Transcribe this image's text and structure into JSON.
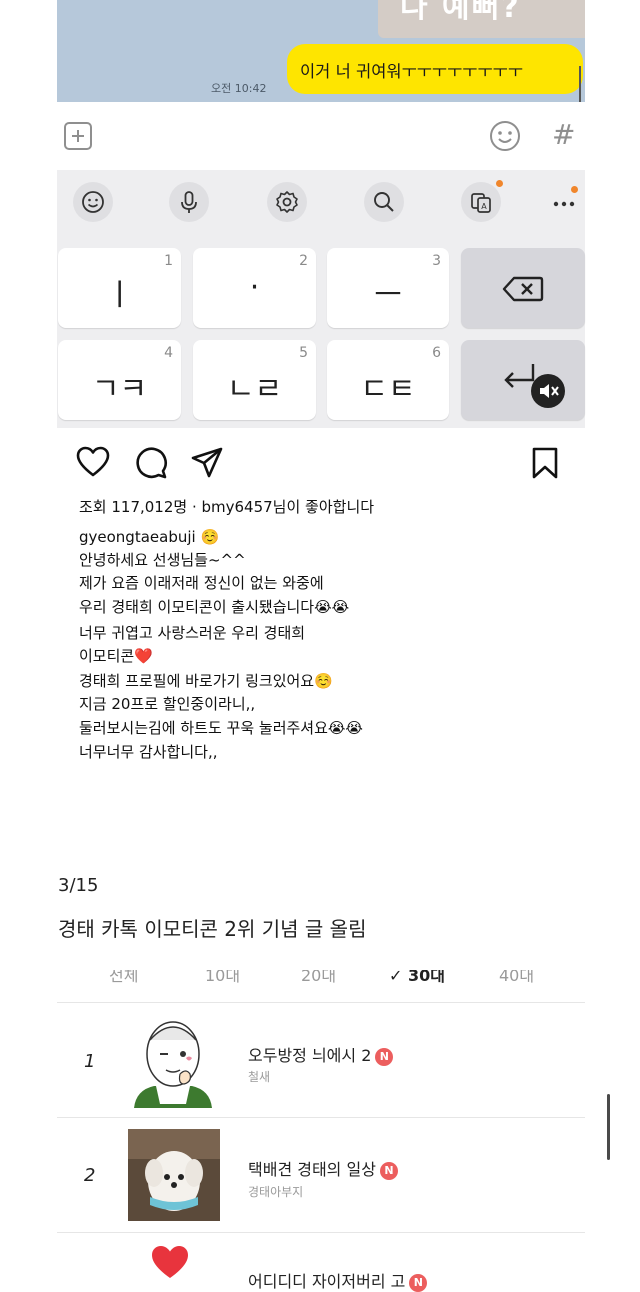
{
  "chat": {
    "photo_caption": "다 예뻐?",
    "my_message": "이거 너 귀여워ㅜㅜㅜㅜㅜㅜㅜㅜ",
    "time": "오전 10:42"
  },
  "input_bar": {
    "plus_icon": "plus-square-icon",
    "emoji_icon": "smiley-icon",
    "hash_symbol": "#"
  },
  "keyboard": {
    "toolbar_icons": [
      "smiley-icon",
      "microphone-icon",
      "gear-icon",
      "search-icon",
      "translate-icon",
      "more-icon"
    ],
    "keys": [
      {
        "num": "1",
        "label": "ㅣ"
      },
      {
        "num": "2",
        "label": "·"
      },
      {
        "num": "3",
        "label": "ㅡ"
      },
      {
        "num": "4",
        "label": "ㄱㅋ"
      },
      {
        "num": "5",
        "label": "ㄴㄹ"
      },
      {
        "num": "6",
        "label": "ㄷㅌ"
      }
    ],
    "backspace_icon": "backspace-icon",
    "enter_icon": "enter-icon",
    "mute_icon": "mute-icon"
  },
  "post": {
    "action_icons": [
      "heart-icon",
      "comment-icon",
      "share-icon",
      "bookmark-icon"
    ],
    "likes_line": "조회 117,012명 · bmy6457님이 좋아합니다",
    "username": "gyeongtaeabuji",
    "caption_lines": [
      "안녕하세요 선생님들~^^",
      "제가 요즘 이래저래 정신이 없는 와중에",
      "우리 경태희 이모티콘이 출시됐습니다😭😭",
      "너무 귀엽고 사랑스러운 우리 경태희",
      "이모티콘❤️",
      "경태희 프로필에 바로가기 링크있어요☺️",
      "지금 20프로 할인중이라니,,",
      "둘러보시는김에 하트도 꾸욱 눌러주셔요😭😭",
      "너무너무 감사합니다,,"
    ],
    "username_emoji": "☺️"
  },
  "note": {
    "date": "3/15",
    "headline": "경태 카톡 이모티콘 2위 기념 글 올림"
  },
  "ranking": {
    "age_tabs": [
      "전체",
      "10대",
      "20대",
      "30대",
      "40대"
    ],
    "active_tab": "30대",
    "items": [
      {
        "rank": "1",
        "title": "오두방정 늬에시 2",
        "author": "철새",
        "badge": "N"
      },
      {
        "rank": "2",
        "title": "택배견 경태의 일상",
        "author": "경태아부지",
        "badge": "N"
      },
      {
        "rank": "3",
        "title": "어디디디 자이저버리 고",
        "author": "",
        "badge": "N"
      }
    ]
  }
}
